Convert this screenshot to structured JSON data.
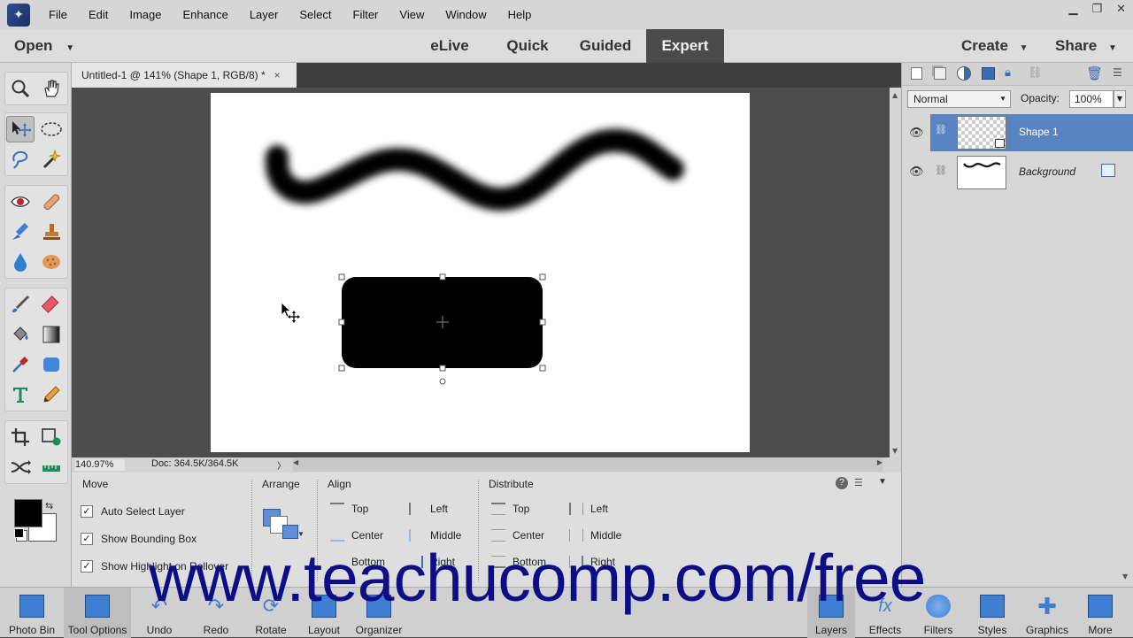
{
  "menubar": {
    "items": [
      "File",
      "Edit",
      "Image",
      "Enhance",
      "Layer",
      "Select",
      "Filter",
      "View",
      "Window",
      "Help"
    ]
  },
  "window_controls": {
    "minimize": "▁",
    "restore": "❐",
    "close": "✕"
  },
  "modebar": {
    "open_label": "Open",
    "modes": [
      "eLive",
      "Quick",
      "Guided",
      "Expert"
    ],
    "active_mode": "Expert",
    "create_label": "Create",
    "share_label": "Share"
  },
  "document": {
    "tab_title": "Untitled-1 @ 141% (Shape 1, RGB/8) *",
    "close_glyph": "×"
  },
  "status": {
    "zoom": "140.97%",
    "doc_size": "Doc: 364.5K/364.5K"
  },
  "tool_options": {
    "tool_name": "Move",
    "checkboxes": [
      "Auto Select Layer",
      "Show Bounding Box",
      "Show Highlight on Rollover"
    ],
    "arrange_label": "Arrange",
    "align_label": "Align",
    "align_items": [
      "Top",
      "Center",
      "Bottom",
      "Left",
      "Middle",
      "Right"
    ],
    "distribute_label": "Distribute",
    "distribute_items": [
      "Top",
      "Center",
      "Bottom",
      "Left",
      "Middle",
      "Right"
    ]
  },
  "layers_panel": {
    "blend_mode": "Normal",
    "opacity_label": "Opacity:",
    "opacity_value": "100%",
    "layers": [
      {
        "name": "Shape 1",
        "selected": true
      },
      {
        "name": "Background",
        "selected": false
      }
    ]
  },
  "taskbar": {
    "left": [
      "Photo Bin",
      "Tool Options",
      "Undo",
      "Redo",
      "Rotate",
      "Layout",
      "Organizer"
    ],
    "right": [
      "Layers",
      "Effects",
      "Filters",
      "Styles",
      "Graphics",
      "More"
    ]
  },
  "watermark": "www.teachucomp.com/free",
  "colors": {
    "accent": "#5a83c2",
    "watermark": "#0d0d86",
    "expert_tab": "#4b4b4b"
  },
  "icons": {
    "foreground_color": "#000000",
    "background_color": "#ffffff"
  }
}
